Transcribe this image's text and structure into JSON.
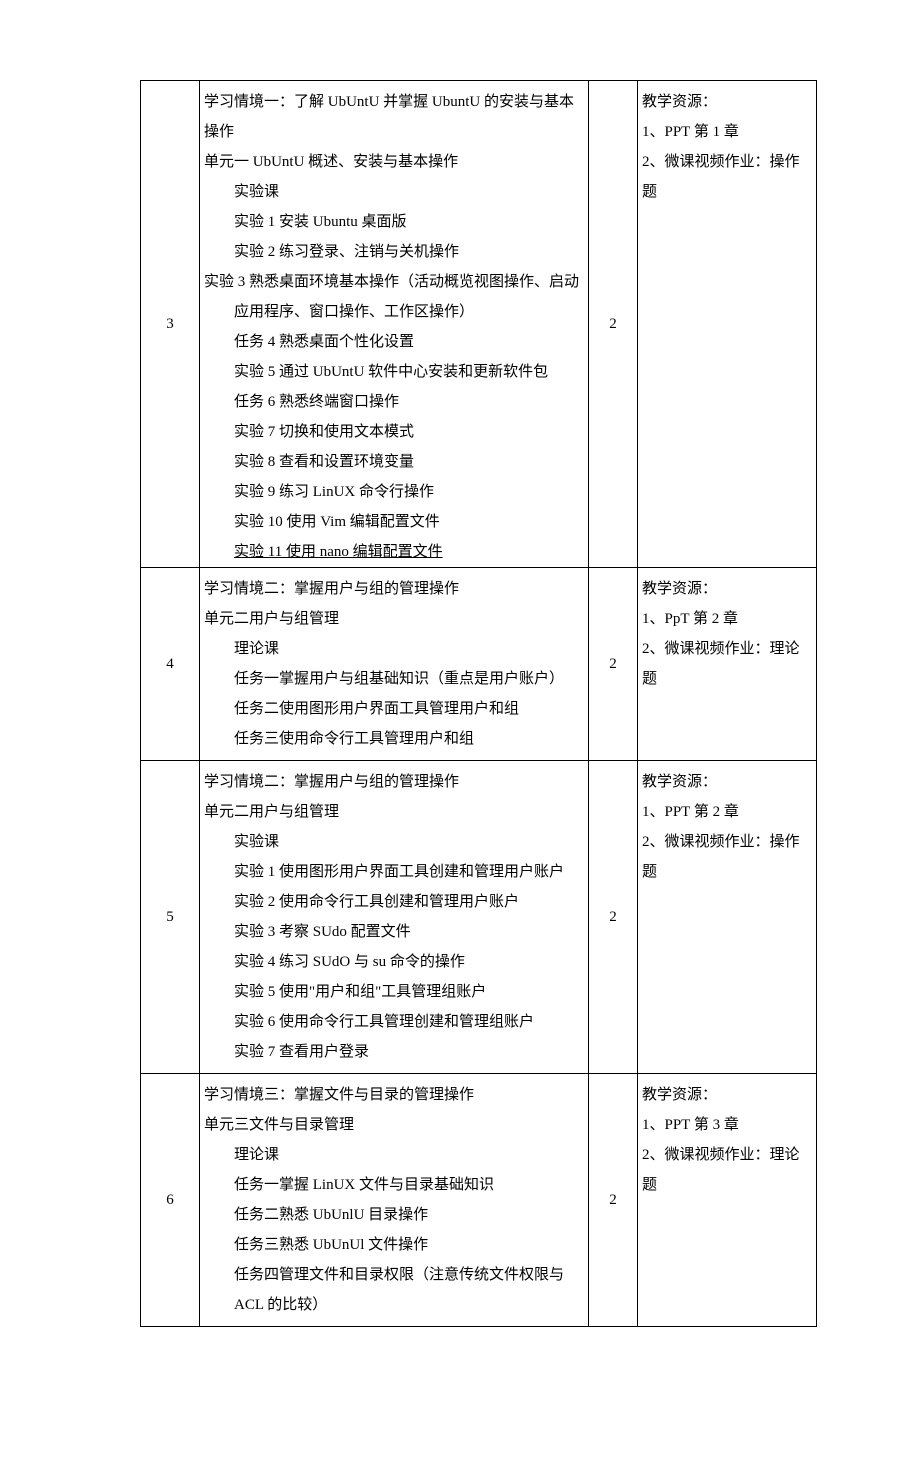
{
  "rows": [
    {
      "num": "3",
      "hours": "2",
      "content": {
        "title": "学习情境一：了解 UbUntU 并掌握 UbuntU 的安装与基本操作",
        "unit": "单元一 UbUntU 概述、安装与基本操作",
        "type": "实验课",
        "items": [
          "实验 1 安装 Ubuntu 桌面版",
          "实验 2 练习登录、注销与关机操作",
          "实验 3 熟悉桌面环境基本操作（活动概览视图操作、启动应用程序、窗口操作、工作区操作）",
          "任务 4 熟悉桌面个性化设置",
          "实验 5 通过 UbUntU 软件中心安装和更新软件包",
          "任务 6 熟悉终端窗口操作",
          "实验 7 切换和使用文本模式",
          "实验 8 查看和设置环境变量",
          "实验 9 练习 LinUX 命令行操作",
          "实验 10 使用 Vim 编辑配置文件",
          "实验 11 使用 nano 编辑配置文件"
        ]
      },
      "resources": {
        "label": "教学资源：",
        "line1": "1、PPT 第 1 章",
        "line2": "2、微课视频作业：操作题"
      }
    },
    {
      "num": "4",
      "hours": "2",
      "content": {
        "title": "学习情境二：掌握用户与组的管理操作",
        "unit": "单元二用户与组管理",
        "type": "理论课",
        "items": [
          "任务一掌握用户与组基础知识（重点是用户账户）",
          "任务二使用图形用户界面工具管理用户和组",
          "任务三使用命令行工具管理用户和组"
        ]
      },
      "resources": {
        "label": "教学资源：",
        "line1": "1、PpT 第 2 章",
        "line2": "2、微课视频作业：理论题"
      }
    },
    {
      "num": "5",
      "hours": "2",
      "content": {
        "title": "学习情境二：掌握用户与组的管理操作",
        "unit": "单元二用户与组管理",
        "type": "实验课",
        "items": [
          "实验 1 使用图形用户界面工具创建和管理用户账户",
          "实验 2 使用命令行工具创建和管理用户账户",
          "实验 3 考察 SUdo 配置文件",
          "实验 4 练习 SUdO 与 su 命令的操作",
          "实验 5 使用\"用户和组\"工具管理组账户",
          "实验 6 使用命令行工具管理创建和管理组账户",
          "实验 7 查看用户登录"
        ]
      },
      "resources": {
        "label": "教学资源：",
        "line1": "1、PPT 第 2 章",
        "line2": "2、微课视频作业：操作题"
      }
    },
    {
      "num": "6",
      "hours": "2",
      "content": {
        "title": "学习情境三：掌握文件与目录的管理操作",
        "unit": "单元三文件与目录管理",
        "type": "理论课",
        "items": [
          "任务一掌握 LinUX 文件与目录基础知识",
          "任务二熟悉 UbUnlU 目录操作",
          "任务三熟悉 UbUnUl 文件操作",
          "任务四管理文件和目录权限（注意传统文件权限与 ACL 的比较）"
        ]
      },
      "resources": {
        "label": "教学资源：",
        "line1": "1、PPT 第 3 章",
        "line2": "2、微课视频作业：理论题"
      }
    }
  ]
}
